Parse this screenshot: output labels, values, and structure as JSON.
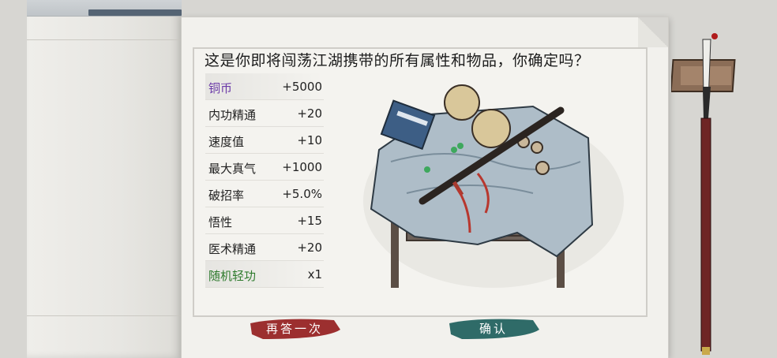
{
  "dialog": {
    "question": "这是你即将闯荡江湖携带的所有属性和物品，你确定吗？"
  },
  "stats": [
    {
      "name": "铜币",
      "value": "+5000",
      "color": "purple"
    },
    {
      "name": "内功精通",
      "value": "+20",
      "color": "normal"
    },
    {
      "name": "速度值",
      "value": "+10",
      "color": "normal"
    },
    {
      "name": "最大真气",
      "value": "+1000",
      "color": "normal"
    },
    {
      "name": "破招率",
      "value": "+5.0%",
      "color": "normal"
    },
    {
      "name": "悟性",
      "value": "+15",
      "color": "normal"
    },
    {
      "name": "医术精通",
      "value": "+20",
      "color": "normal"
    },
    {
      "name": "随机轻功",
      "value": "x1",
      "color": "green"
    }
  ],
  "buttons": {
    "retry_label": "再答一次",
    "confirm_label": "确认"
  },
  "colors": {
    "retry_bg": "#9c2f2f",
    "confirm_bg": "#2f6b68",
    "purple_text": "#6b3aa8",
    "green_text": "#2f7b2e"
  },
  "icons": {
    "illustration": "table-with-gourd-sword-books-illustration",
    "brush": "calligraphy-brush-icon"
  }
}
